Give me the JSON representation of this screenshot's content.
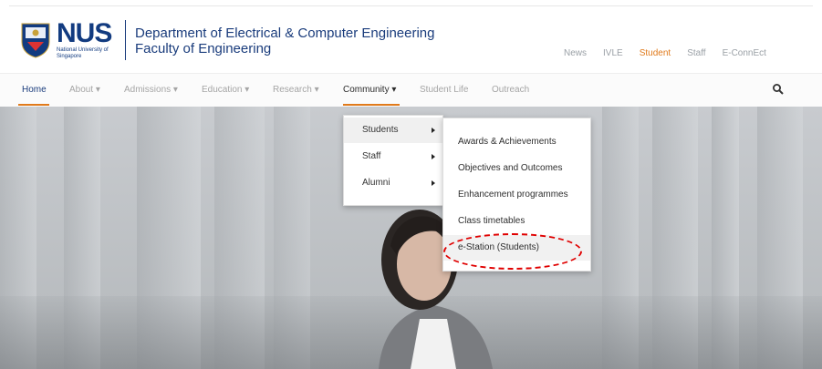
{
  "header": {
    "logo_text": "NUS",
    "logo_subtext": "National University of Singapore",
    "dept_title": "Department of Electrical & Computer Engineering",
    "faculty": "Faculty of Engineering",
    "top_nav": [
      "News",
      "IVLE",
      "Student",
      "Staff",
      "E-ConnEct"
    ],
    "top_nav_active": "Student"
  },
  "main_nav": {
    "items": [
      "Home",
      "About ▾",
      "Admissions ▾",
      "Education ▾",
      "Research ▾",
      "Community ▾",
      "Student Life",
      "Outreach"
    ],
    "active": "Home",
    "open": "Community"
  },
  "community_menu": {
    "items": [
      "Students",
      "Staff",
      "Alumni"
    ],
    "selected": "Students"
  },
  "students_submenu": {
    "items": [
      "Awards & Achievements",
      "Objectives and Outcomes",
      "Enhancement programmes",
      "Class timetables",
      "e-Station (Students)"
    ],
    "highlighted": "e-Station (Students)"
  },
  "colors": {
    "nus_blue": "#1a3c7c",
    "accent_orange": "#e07a1b",
    "highlight_red": "#e00000"
  },
  "icons": [
    "nus-crest-icon",
    "search-icon",
    "submenu-arrow-icon"
  ]
}
